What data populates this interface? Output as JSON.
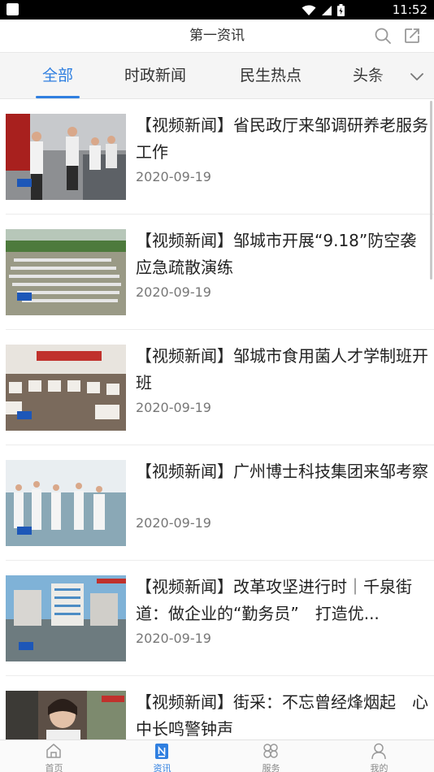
{
  "status_bar": {
    "time": "11:52",
    "icons": [
      "wifi-icon",
      "signal-icon",
      "battery-icon"
    ]
  },
  "header": {
    "title": "第一资讯",
    "icons": [
      "search-icon",
      "share-icon"
    ]
  },
  "tabs": [
    {
      "label": "全部",
      "active": true
    },
    {
      "label": "时政新闻",
      "active": false
    },
    {
      "label": "民生热点",
      "active": false
    },
    {
      "label": "头条",
      "active": false
    }
  ],
  "tabs_more_icon": "chevron-down-icon",
  "news": [
    {
      "title": "【视频新闻】省民政厅来邹调研养老服务工作",
      "date": "2020-09-19"
    },
    {
      "title": "【视频新闻】邹城市开展“9.18”防空袭应急疏散演练",
      "date": "2020-09-19"
    },
    {
      "title": "【视频新闻】邹城市食用菌人才学制班开班",
      "date": "2020-09-19"
    },
    {
      "title": "【视频新闻】广州博士科技集团来邹考察",
      "date": "2020-09-19"
    },
    {
      "title": "【视频新闻】改革攻坚进行时｜千泉街道：做企业的“勤务员”　打造优...",
      "date": "2020-09-19"
    },
    {
      "title": "【视频新闻】街采：不忘曾经烽烟起　心中长鸣警钟声",
      "date": ""
    }
  ],
  "bottom_nav": [
    {
      "label": "首页",
      "icon": "home-icon",
      "active": false
    },
    {
      "label": "资讯",
      "icon": "news-icon",
      "active": true
    },
    {
      "label": "服务",
      "icon": "services-icon",
      "active": false
    },
    {
      "label": "我的",
      "icon": "profile-icon",
      "active": false
    }
  ],
  "colors": {
    "accent": "#2f7fe0",
    "status_bar": "#000000",
    "tab_bar_bg": "#f5f5f5"
  }
}
